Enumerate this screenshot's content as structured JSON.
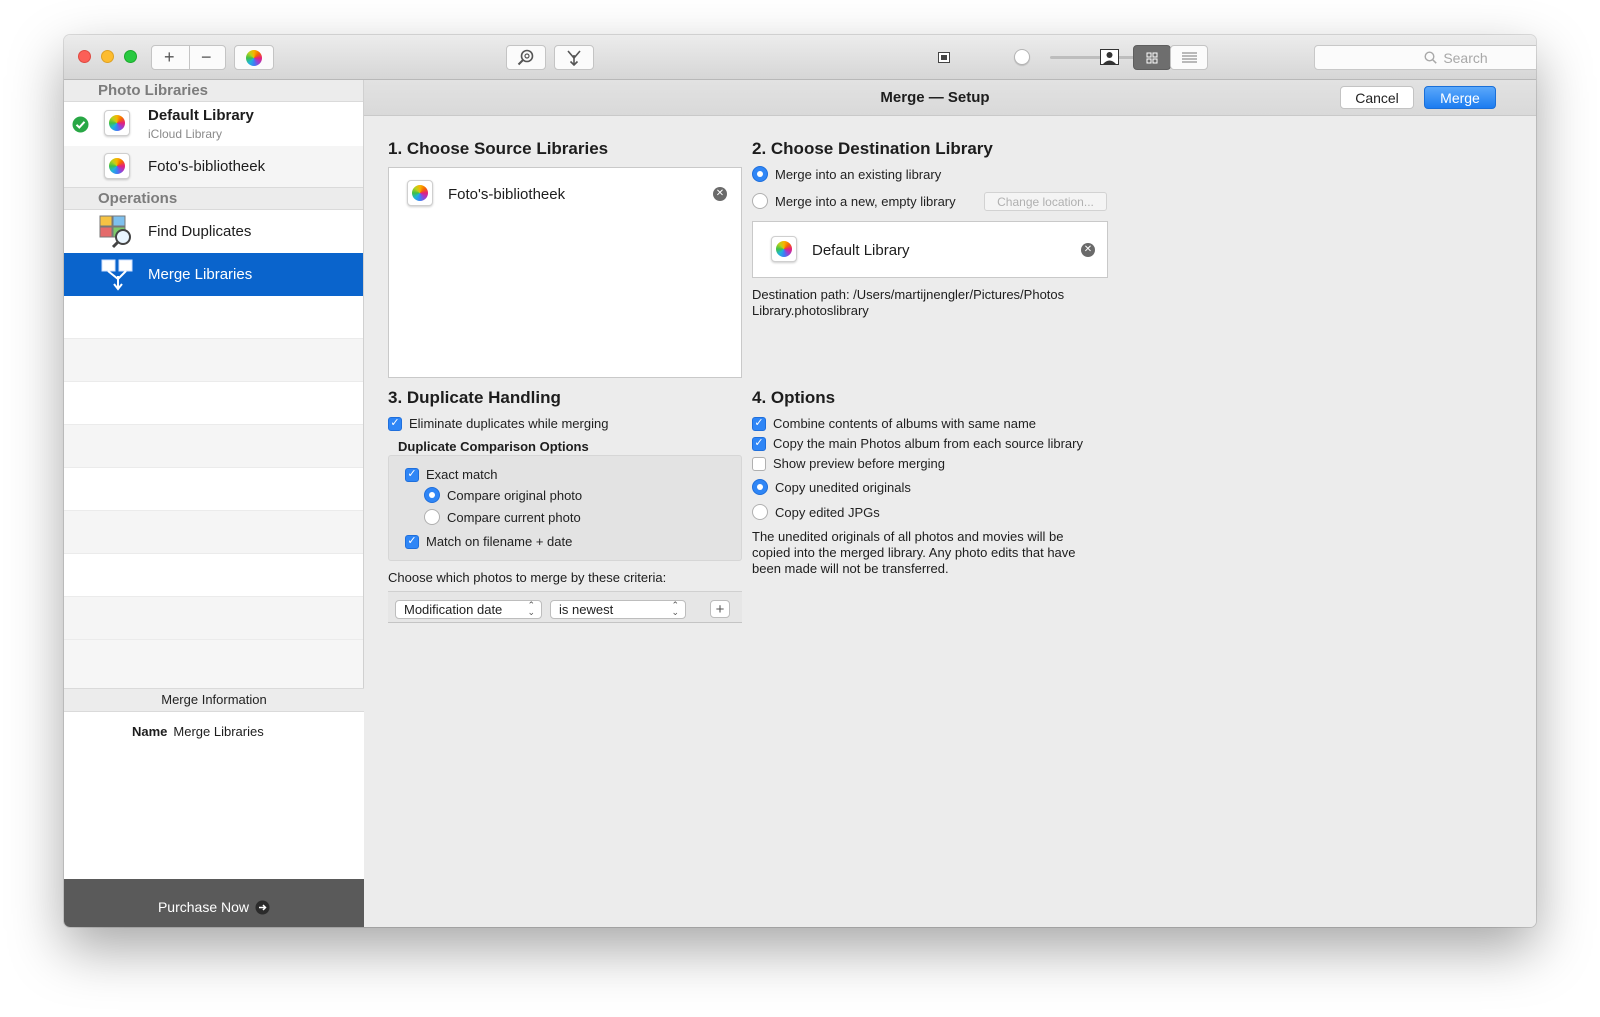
{
  "toolbar": {
    "add_label": "+",
    "remove_label": "−",
    "search_placeholder": "Search"
  },
  "sidebar": {
    "photo_libraries_header": "Photo Libraries",
    "libraries": [
      {
        "name": "Default Library",
        "subtitle": "iCloud Library"
      },
      {
        "name": "Foto's-bibliotheek"
      }
    ],
    "operations_header": "Operations",
    "operations": [
      {
        "label": "Find Duplicates"
      },
      {
        "label": "Merge Libraries"
      }
    ],
    "merge_info_header": "Merge Information",
    "merge_info_name_key": "Name",
    "merge_info_name_value": "Merge Libraries",
    "purchase_label": "Purchase Now"
  },
  "main": {
    "title": "Merge — Setup",
    "cancel_label": "Cancel",
    "merge_label": "Merge",
    "source": {
      "heading": "1. Choose Source Libraries",
      "items": [
        "Foto's-bibliotheek"
      ]
    },
    "destination": {
      "heading": "2. Choose Destination Library",
      "opt_existing": "Merge into an existing library",
      "opt_new": "Merge into a new, empty library",
      "change_location": "Change location...",
      "library_name": "Default Library",
      "path_text": "Destination path: /Users/martijnengler/Pictures/Photos Library.photoslibrary"
    },
    "duplicates": {
      "heading": "3. Duplicate Handling",
      "eliminate": "Eliminate duplicates while merging",
      "comparison_header": "Duplicate Comparison Options",
      "exact_match": "Exact match",
      "compare_original": "Compare original photo",
      "compare_current": "Compare current photo",
      "match_filename": "Match on filename + date",
      "criteria_label": "Choose which photos to merge by these criteria:",
      "criteria_field": "Modification date",
      "criteria_condition": "is newest",
      "add_label": "+"
    },
    "options": {
      "heading": "4. Options",
      "combine_albums": "Combine contents of albums with same name",
      "copy_main": "Copy the main Photos album from each source library",
      "show_preview": "Show preview before merging",
      "copy_unedited": "Copy unedited originals",
      "copy_edited": "Copy edited JPGs",
      "description": "The unedited originals of all photos and movies will be copied into the merged library. Any photo edits that have been made will not be transferred."
    }
  },
  "colors": {
    "accent": "#2f86f6",
    "selection": "#0a64cc",
    "success": "#28a745"
  }
}
